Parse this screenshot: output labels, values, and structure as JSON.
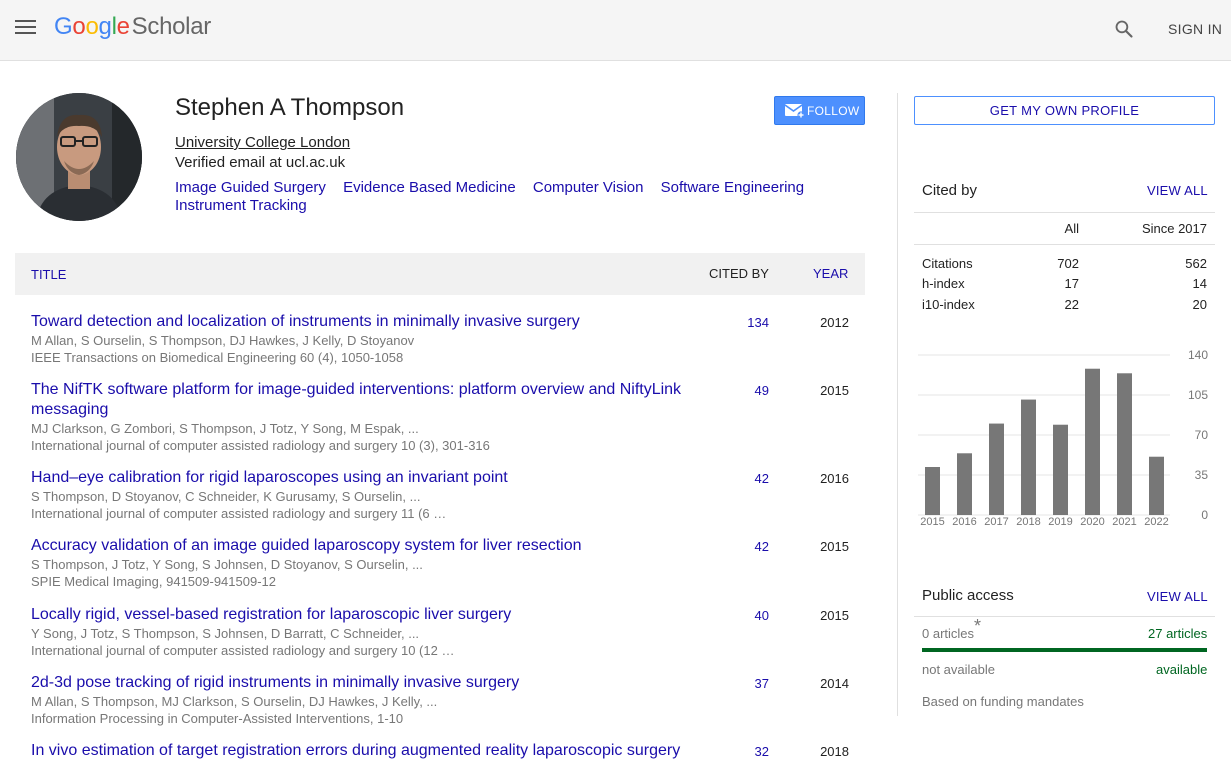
{
  "header": {
    "logo_google": "Google",
    "logo_scholar": "Scholar",
    "signin_label": "SIGN IN",
    "menu_icon": "hamburger-menu-icon",
    "search_icon": "search-icon"
  },
  "profile": {
    "name": "Stephen A Thompson",
    "affiliation": "University College London",
    "email": "Verified email at ucl.ac.uk",
    "interests": [
      "Image Guided Surgery",
      "Evidence Based Medicine",
      "Computer Vision",
      "Software Engineering",
      "Instrument Tracking"
    ],
    "follow_label": "FOLLOW"
  },
  "table": {
    "col_title": "TITLE",
    "col_cited": "CITED BY",
    "col_year": "YEAR",
    "rows": [
      {
        "title": "Toward detection and localization of instruments in minimally invasive surgery",
        "authors": "M Allan, S Ourselin, S Thompson, DJ Hawkes, J Kelly, D Stoyanov",
        "venue": "IEEE Transactions on Biomedical Engineering 60 (4), 1050-1058",
        "cited": "134",
        "year": "2012"
      },
      {
        "title": "The NifTK software platform for image-guided interventions: platform overview and NiftyLink messaging",
        "authors": "MJ Clarkson, G Zombori, S Thompson, J Totz, Y Song, M Espak, ...",
        "venue": "International journal of computer assisted radiology and surgery 10 (3), 301-316",
        "cited": "49",
        "year": "2015"
      },
      {
        "title": "Hand–eye calibration for rigid laparoscopes using an invariant point",
        "authors": "S Thompson, D Stoyanov, C Schneider, K Gurusamy, S Ourselin, ...",
        "venue": "International journal of computer assisted radiology and surgery 11 (6 …",
        "cited": "42",
        "year": "2016"
      },
      {
        "title": "Accuracy validation of an image guided laparoscopy system for liver resection",
        "authors": "S Thompson, J Totz, Y Song, S Johnsen, D Stoyanov, S Ourselin, ...",
        "venue": "SPIE Medical Imaging, 941509-941509-12",
        "cited": "42",
        "year": "2015"
      },
      {
        "title": "Locally rigid, vessel-based registration for laparoscopic liver surgery",
        "authors": "Y Song, J Totz, S Thompson, S Johnsen, D Barratt, C Schneider, ...",
        "venue": "International journal of computer assisted radiology and surgery 10 (12 …",
        "cited": "40",
        "year": "2015"
      },
      {
        "title": "2d-3d pose tracking of rigid instruments in minimally invasive surgery",
        "authors": "M Allan, S Thompson, MJ Clarkson, S Ourselin, DJ Hawkes, J Kelly, ...",
        "venue": "Information Processing in Computer-Assisted Interventions, 1-10",
        "cited": "37",
        "year": "2014"
      },
      {
        "title": "In vivo estimation of target registration errors during augmented reality laparoscopic surgery",
        "authors": "",
        "venue": "",
        "cited": "32",
        "year": "2018"
      }
    ]
  },
  "sidebar": {
    "get_profile_label": "GET MY OWN PROFILE",
    "cited_by": {
      "title": "Cited by",
      "view_all": "VIEW ALL",
      "col_all": "All",
      "col_since": "Since 2017",
      "rows": [
        {
          "label": "Citations",
          "all": "702",
          "since": "562"
        },
        {
          "label": "h-index",
          "all": "17",
          "since": "14"
        },
        {
          "label": "i10-index",
          "all": "22",
          "since": "20"
        }
      ]
    },
    "public_access": {
      "title": "Public access",
      "view_all": "VIEW ALL",
      "left_count": "0 articles",
      "star": "*",
      "right_count": "27 articles",
      "left_label": "not available",
      "right_label": "available",
      "note": "Based on funding mandates"
    }
  },
  "chart_data": {
    "type": "bar",
    "categories": [
      "2015",
      "2016",
      "2017",
      "2018",
      "2019",
      "2020",
      "2021",
      "2022"
    ],
    "values": [
      42,
      54,
      80,
      101,
      79,
      128,
      124,
      51
    ],
    "ylim": [
      0,
      140
    ],
    "yticks": [
      "140",
      "105",
      "70",
      "35",
      "0"
    ],
    "bar_color": "#777777",
    "grid": true
  },
  "colors": {
    "link": "#1a0dab",
    "follow_button": "#4d90fe",
    "available_green": "#006621"
  }
}
